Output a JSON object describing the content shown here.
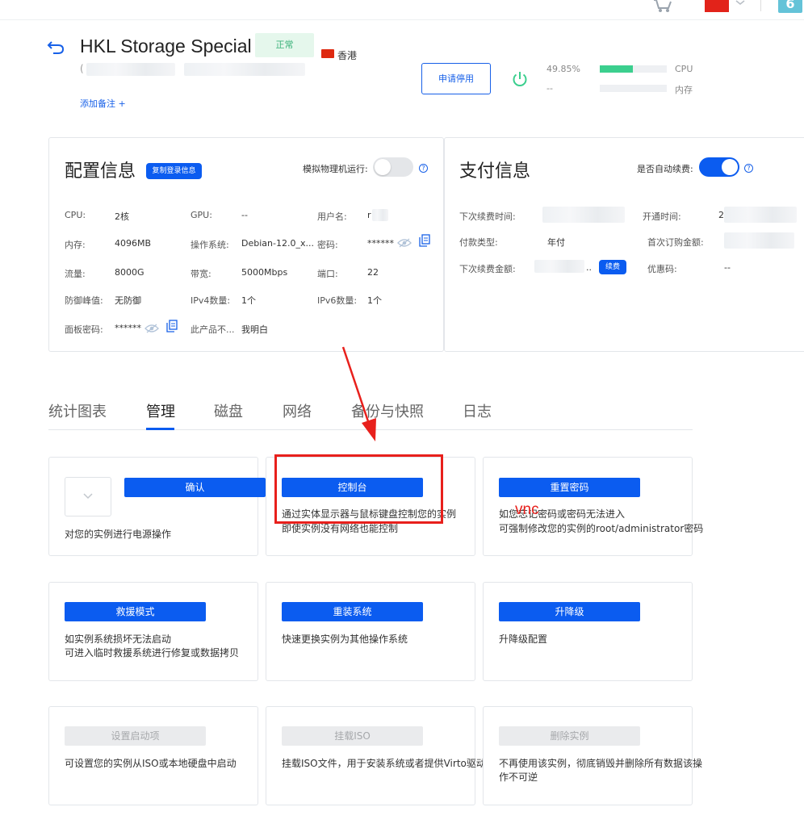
{
  "topbar": {
    "notification_count": "6"
  },
  "header": {
    "title": "HKL Storage Special",
    "status": "正常",
    "region": "香港",
    "add_note": "添加备注 +",
    "suspend_button": "申请停用",
    "cpu_percent": "49.85%",
    "cpu_usage": 0.4985,
    "mem_percent": "--",
    "cpu_label": "CPU",
    "mem_label": "内存"
  },
  "config": {
    "title": "配置信息",
    "copy_login_button": "复制登录信息",
    "physical_mode_label": "模拟物理机运行:",
    "rows": {
      "cpu_label": "CPU:",
      "cpu_value": "2核",
      "gpu_label": "GPU:",
      "gpu_value": "--",
      "username_label": "用户名:",
      "username_value": "r",
      "memory_label": "内存:",
      "memory_value": "4096MB",
      "os_label": "操作系统:",
      "os_value": "Debian-12.0_x...",
      "password_label": "密码:",
      "password_value": "******",
      "traffic_label": "流量:",
      "traffic_value": "8000G",
      "bandwidth_label": "带宽:",
      "bandwidth_value": "5000Mbps",
      "port_label": "端口:",
      "port_value": "22",
      "ddos_label": "防御峰值:",
      "ddos_value": "无防御",
      "ipv4_label": "IPv4数量:",
      "ipv4_value": "1个",
      "ipv6_label": "IPv6数量:",
      "ipv6_value": "1个",
      "panel_pw_label": "面板密码:",
      "panel_pw_value": "******",
      "notice_label": "此产品不...",
      "notice_value": "我明白"
    }
  },
  "payment": {
    "title": "支付信息",
    "auto_renew_label": "是否自动续费:",
    "next_renew_time_label": "下次续费时间:",
    "open_time_label": "开通时间:",
    "open_time_value": "2",
    "pay_type_label": "付款类型:",
    "pay_type_value": "年付",
    "first_order_label": "首次订购金额:",
    "next_amount_label": "下次续费金额:",
    "next_amount_value": "..",
    "renew_button": "续费",
    "coupon_label": "优惠码:",
    "coupon_value": "--"
  },
  "tabs": [
    "统计图表",
    "管理",
    "磁盘",
    "网络",
    "备份与快照",
    "日志"
  ],
  "actions": {
    "power": {
      "button": "确认",
      "desc": "对您的实例进行电源操作"
    },
    "console": {
      "button": "控制台",
      "desc1": "通过实体显示器与鼠标键盘控制您的实例",
      "desc2": "即使实例没有网络也能控制"
    },
    "reset_pw": {
      "button": "重置密码",
      "desc1": "如您忘记密码或密码无法进入",
      "desc2": "可强制修改您的实例的root/administrator密码"
    },
    "rescue": {
      "button": "救援模式",
      "desc1": "如实例系统损坏无法启动",
      "desc2": "可进入临时救援系统进行修复或数据拷贝"
    },
    "reinstall": {
      "button": "重装系统",
      "desc": "快速更换实例为其他操作系统"
    },
    "upgrade": {
      "button": "升降级",
      "desc": "升降级配置"
    },
    "boot": {
      "button": "设置启动项",
      "desc": "可设置您的实例从ISO或本地硬盘中启动"
    },
    "iso": {
      "button": "挂载ISO",
      "desc": "挂载ISO文件，用于安装系统或者提供Virto驱动"
    },
    "delete": {
      "button": "删除实例",
      "desc1": "不再使用该实例，彻底销毁并删除所有数据该操",
      "desc2": "作不可逆"
    }
  },
  "annotation": {
    "text": "vnc",
    "color": "#e8201c"
  },
  "colors": {
    "accent": "#0b5cf0",
    "status_green": "#3bcf8e",
    "annotation_red": "#e8201c"
  }
}
